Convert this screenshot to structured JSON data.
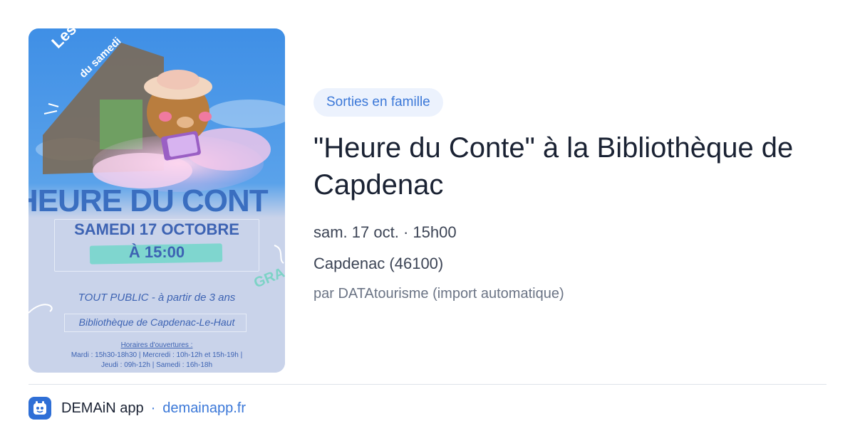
{
  "poster": {
    "arc_title": "Les histoires",
    "arc_subtitle": "du samedi",
    "headline": "HEURE DU CONT",
    "date": "SAMEDI 17 OCTOBRE",
    "time": "À 15:00",
    "side_text": "GRA",
    "audience": "TOUT PUBLIC - à partir de 3 ans",
    "library": "Bibliothèque de Capdenac-Le-Haut",
    "hours_title": "Horaires d'ouvertures :",
    "hours_line1": "Mardi : 15h30-18h30  |  Mercredi : 10h-12h et 15h-19h  |",
    "hours_line2": "Jeudi : 09h-12h  |  Samedi : 16h-18h"
  },
  "event": {
    "category": "Sorties en famille",
    "title": "\"Heure du Conte\" à la Bibliothèque de Capdenac",
    "datetime": "sam. 17 oct. · 15h00",
    "location": "Capdenac (46100)",
    "source": "par DATAtourisme (import automatique)"
  },
  "footer": {
    "app_name": "DEMAiN app",
    "separator": "·",
    "domain": "demainapp.fr"
  },
  "colors": {
    "accent": "#3b78d8",
    "tag_bg": "#ecf2fd",
    "logo_bg": "#2f6fd6"
  },
  "icons": {
    "app_logo": "demain-app-logo-icon"
  }
}
